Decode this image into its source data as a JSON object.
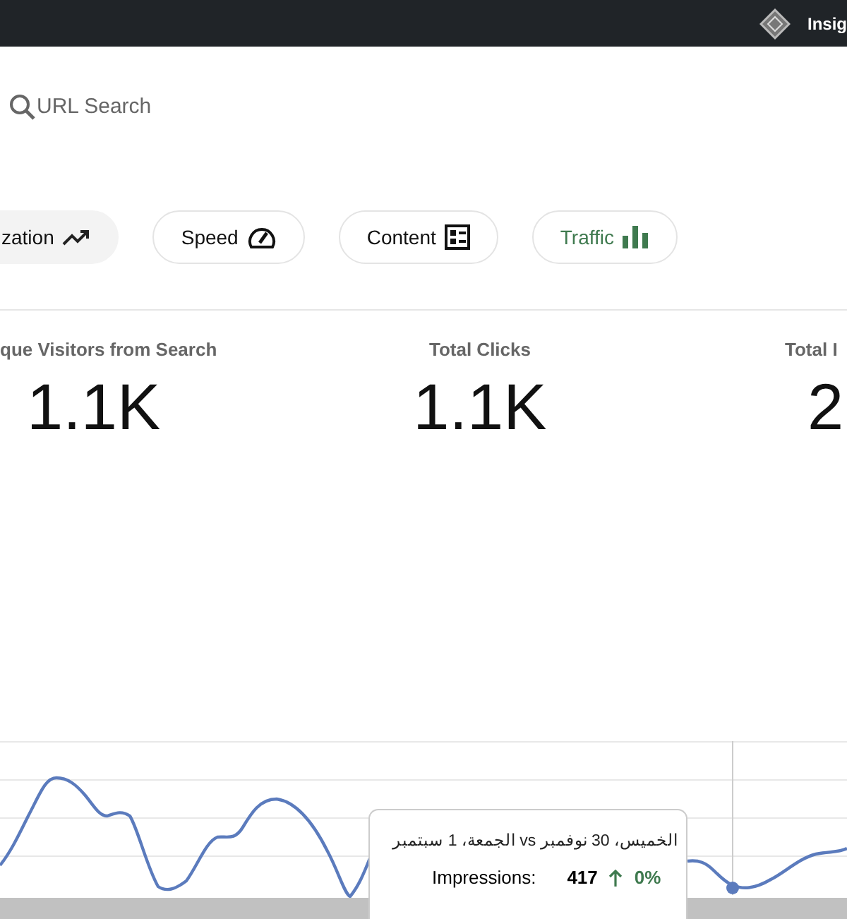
{
  "top_bar": {
    "label": "Insig"
  },
  "search": {
    "placeholder": "URL Search"
  },
  "tabs": [
    {
      "label": "zation",
      "kind": "trend",
      "selected": true,
      "accent": false
    },
    {
      "label": "Speed",
      "kind": "gauge",
      "selected": false,
      "accent": false
    },
    {
      "label": "Content",
      "kind": "list",
      "selected": false,
      "accent": false
    },
    {
      "label": "Traffic",
      "kind": "bars",
      "selected": false,
      "accent": true
    }
  ],
  "stats": [
    {
      "label": "que Visitors from Search",
      "value": "1.1K"
    },
    {
      "label": "Total Clicks",
      "value": "1.1K"
    },
    {
      "label": "Total I",
      "value": "2"
    }
  ],
  "chart": {
    "tooltip": {
      "title": "الخميس، 30 نوفمبر vs الجمعة، 1 سبتمبر",
      "metric": "Impressions:",
      "value": "417",
      "change": "0%"
    }
  }
}
